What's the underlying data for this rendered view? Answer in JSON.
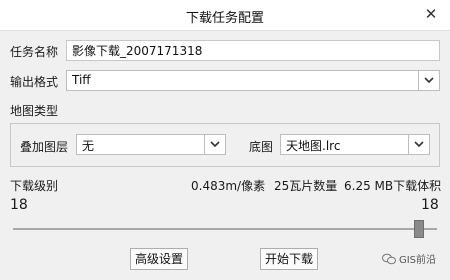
{
  "window": {
    "title": "下载任务配置",
    "close_icon": "close-icon"
  },
  "task": {
    "name_label": "任务名称",
    "name_value": "影像下载_2007171318"
  },
  "format": {
    "label": "输出格式",
    "value": "Tiff"
  },
  "map_type": {
    "section_label": "地图类型",
    "overlay_label": "叠加图层",
    "overlay_value": "无",
    "base_label": "底图",
    "base_value": "天地图.lrc"
  },
  "download": {
    "level_label": "下载级别",
    "resolution": "0.483m/像素",
    "tile_count": "25瓦片数量",
    "volume": "6.25 MB下载体积",
    "level_min_display": "18",
    "level_max_display": "18",
    "level": 18,
    "slider_position_fraction": 1.0
  },
  "buttons": {
    "advanced": "高级设置",
    "start": "开始下载"
  },
  "watermark": {
    "text": "GIS前沿"
  },
  "colors": {
    "background": "#f0f0f0",
    "titlebar": "#ffffff",
    "border": "#c8c8c8"
  }
}
